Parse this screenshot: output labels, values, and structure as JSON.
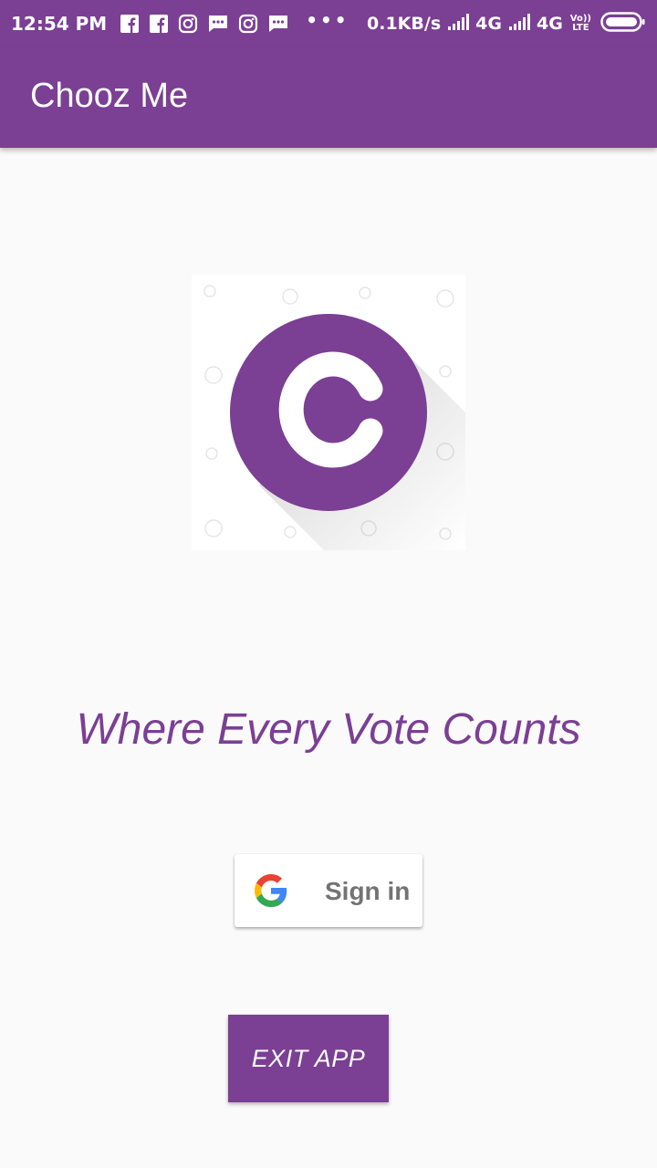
{
  "status_bar": {
    "time": "12:54 PM",
    "network_speed": "0.1KB/s",
    "network_type_1": "4G",
    "network_type_2": "4G",
    "volte_line1": "Vo))",
    "volte_line2": "LTE",
    "icons": [
      "facebook-icon",
      "facebook-icon",
      "instagram-icon",
      "message-icon",
      "instagram-icon",
      "message-icon",
      "more-icon",
      "signal-icon",
      "signal-icon",
      "battery-icon"
    ]
  },
  "app_bar": {
    "title": "Chooz Me"
  },
  "logo": {
    "letter": "C",
    "color": "#7b3f94"
  },
  "tagline": "Where Every Vote Counts",
  "sign_in": {
    "label": "Sign in",
    "icon": "google-icon"
  },
  "exit": {
    "label": "EXIT APP"
  },
  "colors": {
    "primary": "#7b3f94",
    "background": "#fafafa"
  }
}
